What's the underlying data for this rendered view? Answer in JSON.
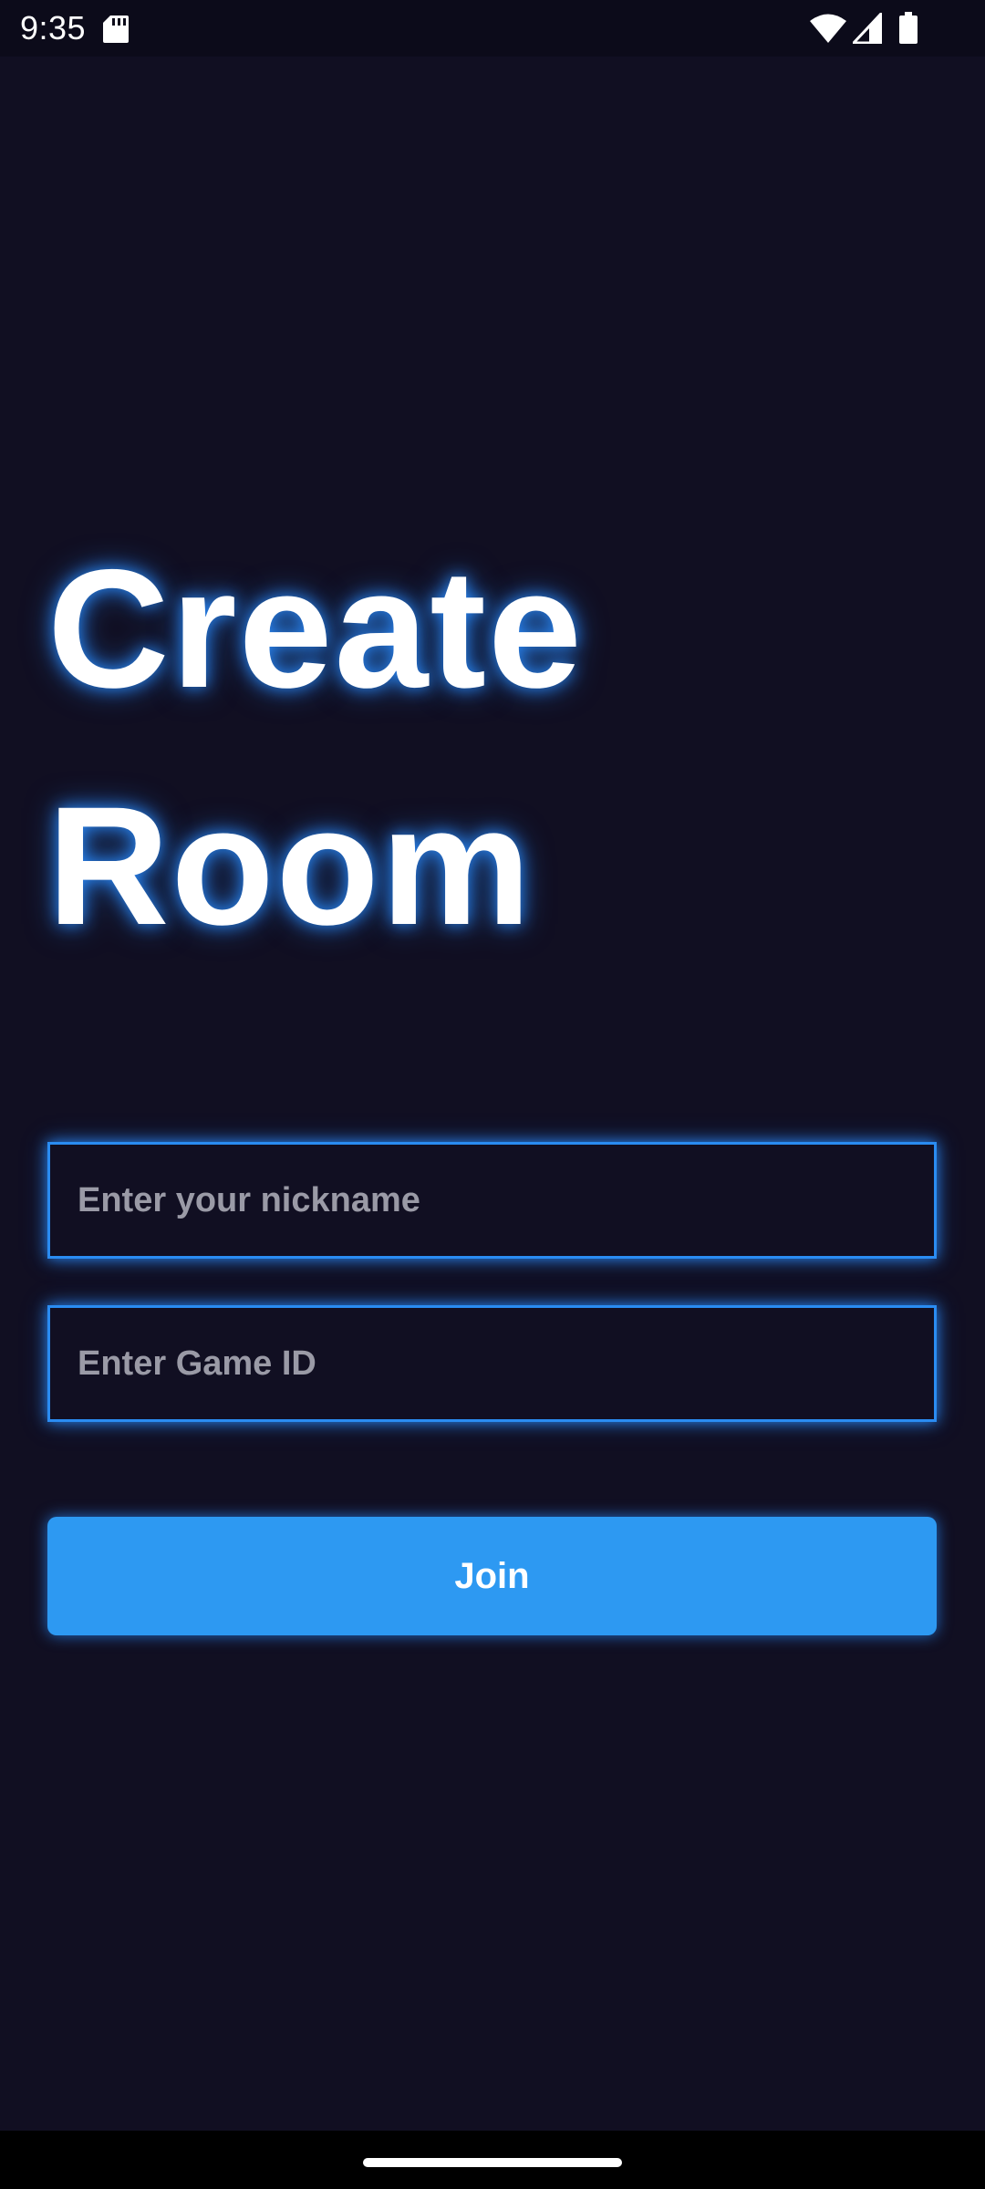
{
  "status_bar": {
    "time": "9:35",
    "icons": [
      "sd-card-icon",
      "wifi-icon",
      "cell-signal-icon",
      "battery-icon"
    ]
  },
  "title": {
    "line1": "Create",
    "line2": "Room"
  },
  "form": {
    "nickname_placeholder": "Enter your nickname",
    "nickname_value": "",
    "game_id_placeholder": "Enter Game ID",
    "game_id_value": "",
    "join_label": "Join"
  },
  "colors": {
    "background": "#110f22",
    "accent": "#2d99f2",
    "glow": "#2a8cff",
    "placeholder": "#9a9aa6"
  }
}
